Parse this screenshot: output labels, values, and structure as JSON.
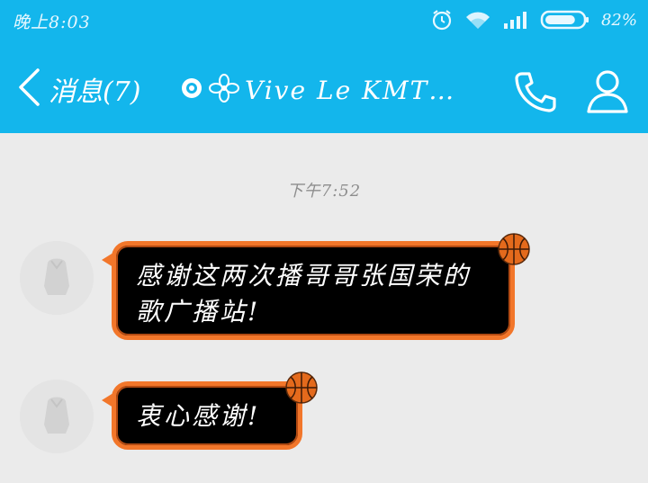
{
  "status_bar": {
    "time": "晚上8:03",
    "battery_percent": "82%",
    "battery_level": 0.82,
    "icons": [
      "alarm-icon",
      "wifi-icon",
      "signal-icon",
      "battery-icon"
    ]
  },
  "nav": {
    "back_label": "消息(7)",
    "title": "Vive Le KMT…",
    "title_prefix_icons": [
      "sun-badge-icon",
      "flower-badge-icon"
    ],
    "call_icon": "phone-icon",
    "profile_icon": "profile-icon"
  },
  "chat": {
    "timestamp": "下午7:52",
    "messages": [
      {
        "line1": "感谢这两次播哥哥张国荣的",
        "line2": "歌广播站!"
      },
      {
        "line1": "衷心感谢!"
      }
    ]
  },
  "colors": {
    "header": "#13b6ec",
    "background": "#ebebeb",
    "bubble_fill": "#000000",
    "bubble_border": "#f2762a",
    "timestamp": "#8d8d8d"
  }
}
